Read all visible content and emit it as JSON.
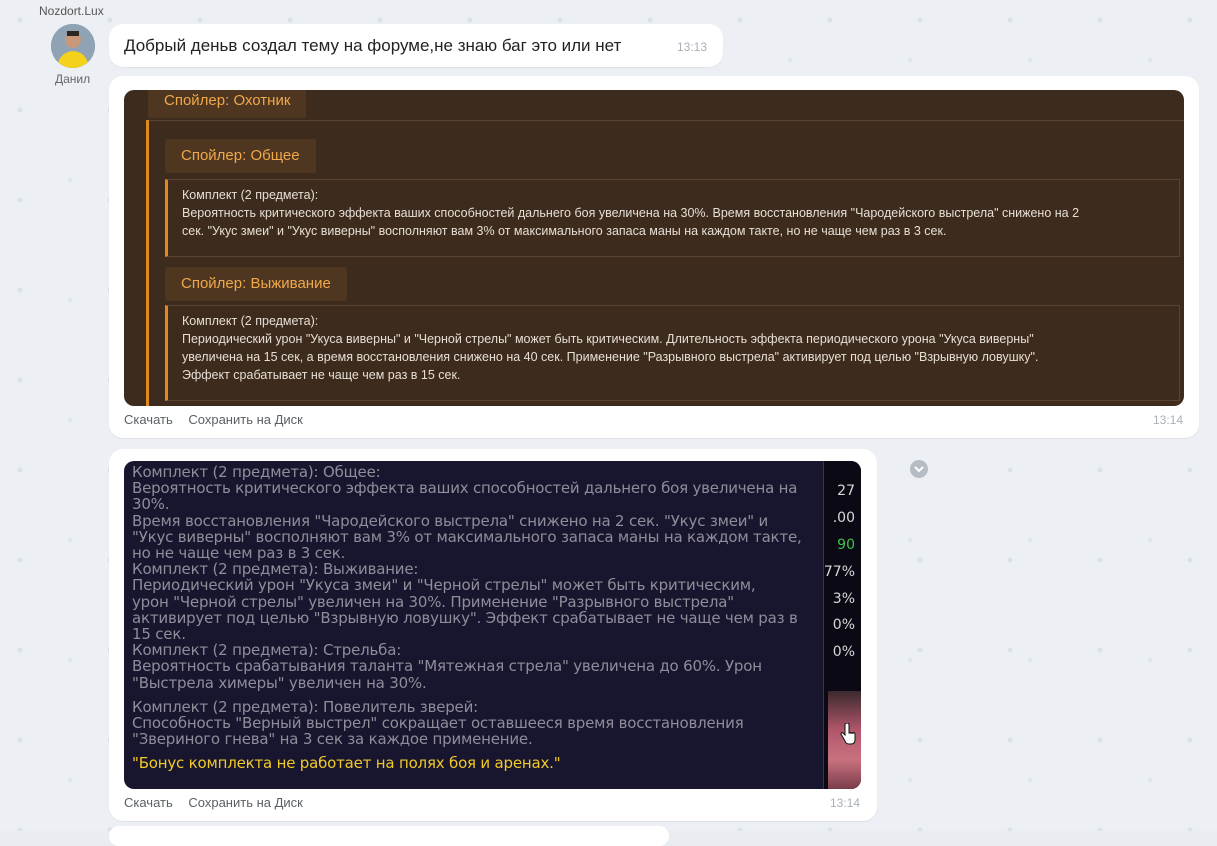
{
  "chat": {
    "sender_name": "Nozdort.Lux",
    "avatar_name": "Данил",
    "msg1": {
      "text": "Добрый деньв создал тему на форуме,не знаю баг это или нет",
      "time": "13:13"
    },
    "msg2": {
      "time": "13:14",
      "actions": {
        "download": "Скачать",
        "save": "Сохранить на Диск"
      },
      "image": {
        "spoiler_outer": "Спойлер: Охотник",
        "spoiler1_title": "Спойлер: Общее",
        "spoiler1_line1": "Комплект (2 предмета):",
        "spoiler1_line2": "Вероятность критического эффекта ваших способностей дальнего боя увеличена на 30%. Время восстановления \"Чародейского выстрела\" снижено на 2",
        "spoiler1_line3": "сек. \"Укус змеи\" и \"Укус виверны\" восполняют вам 3% от максимального запаса маны на каждом такте, но не чаще чем раз в 3 сек.",
        "spoiler2_title": "Спойлер: Выживание",
        "spoiler2_line1": "Комплект (2 предмета):",
        "spoiler2_line2": "Периодический урон \"Укуса виверны\" и \"Черной стрелы\" может быть критическим. Длительность эффекта периодического урона \"Укуса виверны\"",
        "spoiler2_line3": "увеличена на 15 сек, а время восстановления снижено на 40 сек. Применение \"Разрывного выстрела\" активирует под целью \"Взрывную ловушку\".",
        "spoiler2_line4": "Эффект срабатывает не чаще чем раз в 15 сек."
      }
    },
    "msg3": {
      "time": "13:14",
      "actions": {
        "download": "Скачать",
        "save": "Сохранить на Диск"
      },
      "image": {
        "l1": "Комплект (2 предмета): Общее:",
        "l2": "Вероятность критического эффекта ваших способностей дальнего боя увеличена на",
        "l3": "30%.",
        "l4": "Время восстановления \"Чародейского выстрела\" снижено на 2 сек. \"Укус змеи\" и",
        "l5": "\"Укус виверны\" восполняют вам 3% от максимального запаса маны на каждом такте,",
        "l6": "но не чаще чем раз в 3 сек.",
        "l7": "Комплект (2 предмета): Выживание:",
        "l8": "Периодический урон \"Укуса змеи\" и \"Черной стрелы\" может быть критическим,",
        "l9": "урон \"Черной стрелы\" увеличен на 30%. Применение \"Разрывного выстрела\"",
        "l10": "активирует под целью \"Взрывную ловушку\". Эффект срабатывает не чаще чем раз в",
        "l11": "15 сек.",
        "l12": "Комплект (2 предмета): Стрельба:",
        "l13": "Вероятность срабатывания таланта \"Мятежная стрела\" увеличена до 60%. Урон",
        "l14": "\"Выстрела химеры\" увеличен на 30%.",
        "l15": "Комплект (2 предмета): Повелитель зверей:",
        "l16": "Способность \"Верный выстрел\" сокращает оставшееся время восстановления",
        "l17": "\"Звериного гнева\" на 3 сек за каждое применение.",
        "l18": "\"Бонус комплекта не работает на полях боя и аренах.\"",
        "side": [
          "27",
          ".00",
          "90",
          "77%",
          "3%",
          "0%",
          "0%"
        ]
      }
    }
  },
  "colors": {
    "spoiler_accent": "#e08a1e",
    "spoiler_title": "#f0a84a",
    "game_yellow": "#f2c928",
    "game_green": "#3fc24a"
  }
}
